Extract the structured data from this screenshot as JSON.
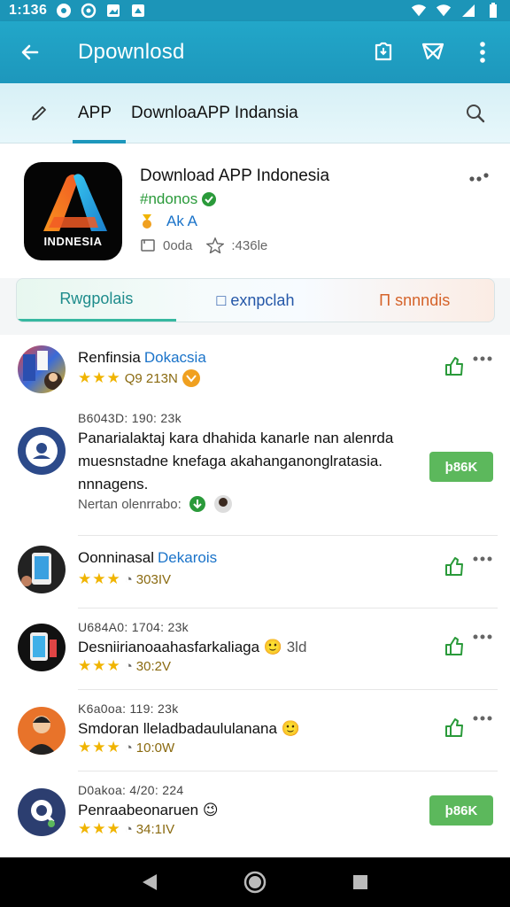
{
  "status_bar": {
    "time": "1:136"
  },
  "app_bar": {
    "title": "Dpownlosd"
  },
  "tabs": {
    "app_tab": "APP",
    "title": "DownloaAPP Indansia"
  },
  "app": {
    "name": "Download APP Indonesia",
    "tag": "#ndonos",
    "sub": "Ak A",
    "meta_size": "0oda",
    "meta_rating": ":436le",
    "logo_text": "INDNESIA"
  },
  "segments": [
    "Rwgpolais",
    "□ exnpclah",
    "Π snnndis"
  ],
  "reviews": [
    {
      "name": "Renfinsia",
      "badge": "Dokacsia",
      "rating_count": "Q9 213N"
    },
    {
      "date": "B6043D: 190: 23k",
      "body": "Panarialaktaj kara dhahida kanarle nan alenrda muesnstadne knefaga akahanganonglratasia. nnnagens.",
      "foot": "Nertan olenrrabo:",
      "button": "ϸ86K"
    },
    {
      "name": "Oonninasal",
      "badge": "Dekarois",
      "rating_count": "303IV"
    },
    {
      "date": "U684A0: 1704: 23k",
      "body": "Desniirianoaahasfarkaliaga",
      "suffix": "3ld",
      "rating_count": "30:2V"
    },
    {
      "date": "K6a0oa: 119: 23k",
      "body": "Smdoran lleladbadaululanana",
      "rating_count": "10:0W"
    },
    {
      "date": "D0akoa: 4/20: 224",
      "body": "Penraabeonaruen",
      "rating_count": "34:1IV",
      "button": "ϸ86K"
    }
  ],
  "colors": {
    "primary": "#1d97bc",
    "star": "#f0b400",
    "green": "#5cb85c"
  }
}
